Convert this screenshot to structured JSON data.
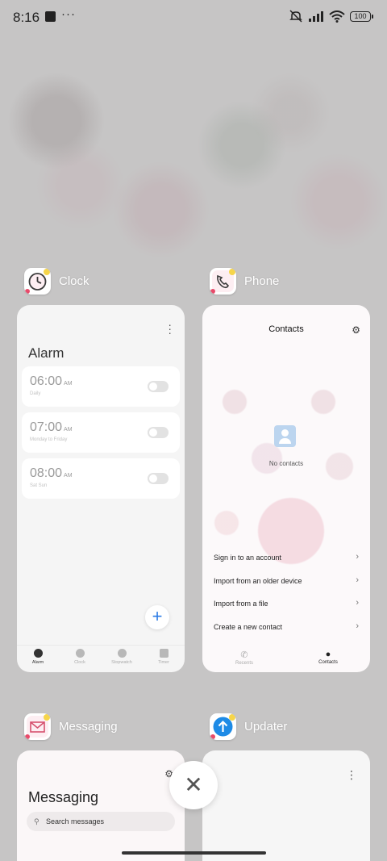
{
  "status_bar": {
    "time": "8:16",
    "overflow": "···",
    "battery": "100",
    "icons": [
      "notification-square-icon",
      "mute-icon",
      "signal-icon",
      "wifi-icon",
      "battery-icon"
    ]
  },
  "apps": {
    "clock": {
      "name": "Clock",
      "screen_title": "Alarm",
      "alarms": [
        {
          "time": "06:00",
          "ampm": "AM",
          "repeat": "Daily"
        },
        {
          "time": "07:00",
          "ampm": "AM",
          "repeat": "Monday to Friday"
        },
        {
          "time": "08:00",
          "ampm": "AM",
          "repeat": "Sat Sun"
        }
      ],
      "add_label": "+",
      "tabs": [
        "Alarm",
        "Clock",
        "Stopwatch",
        "Timer"
      ]
    },
    "phone": {
      "name": "Phone",
      "screen_title": "Contacts",
      "empty_text": "No contacts",
      "options": [
        "Sign in to an account",
        "Import from an older device",
        "Import from a file",
        "Create a new contact"
      ],
      "tabs": [
        "Recents",
        "Contacts"
      ]
    },
    "messaging": {
      "name": "Messaging",
      "screen_title": "Messaging",
      "search_placeholder": "Search messages"
    },
    "updater": {
      "name": "Updater"
    }
  },
  "close_label": "✕"
}
